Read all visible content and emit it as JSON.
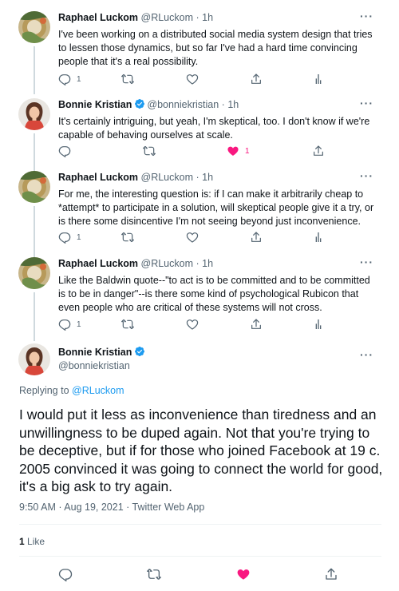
{
  "tweets": [
    {
      "name": "Raphael Luckom",
      "handle": "@RLuckom",
      "time": "1h",
      "verified": false,
      "text": "I've been working on a distributed social media system design that tries to lessen those dynamics, but so far I've had a hard time convincing people that it's a real possibility.",
      "reply_count": "1",
      "retweet_count": "",
      "like_count": "",
      "liked": false
    },
    {
      "name": "Bonnie Kristian",
      "handle": "@bonniekristian",
      "time": "1h",
      "verified": true,
      "text": "It's certainly intriguing, but yeah, I'm skeptical, too. I don't know if we're capable of behaving ourselves at scale.",
      "reply_count": "",
      "retweet_count": "",
      "like_count": "1",
      "liked": true
    },
    {
      "name": "Raphael Luckom",
      "handle": "@RLuckom",
      "time": "1h",
      "verified": false,
      "text": "For me, the interesting question is: if I can make it arbitrarily cheap to *attempt* to participate in a solution, will skeptical people give it a try, or is there some disincentive I'm not seeing beyond just inconvenience.",
      "reply_count": "1",
      "retweet_count": "",
      "like_count": "",
      "liked": false
    },
    {
      "name": "Raphael Luckom",
      "handle": "@RLuckom",
      "time": "1h",
      "verified": false,
      "text": "Like the Baldwin quote--\"to act is to be committed and to be committed is to be in danger\"--is there some kind of psychological Rubicon that even people who are critical of these systems will not cross.",
      "reply_count": "1",
      "retweet_count": "",
      "like_count": "",
      "liked": false
    }
  ],
  "main_tweet": {
    "name": "Bonnie Kristian",
    "handle": "@bonniekristian",
    "verified": true,
    "replying_to_label": "Replying to",
    "replying_to_handle": "@RLuckom",
    "text": "I would put it less as inconvenience than tiredness and an unwillingness to be duped again. Not that you're trying to be deceptive, but if for those who joined Facebook at 19 c. 2005 convinced it was going to connect the world for good, it's a big ask to try again.",
    "timestamp": "9:50 AM · Aug 19, 2021 · Twitter Web App",
    "likes_count": "1",
    "likes_label": "Like",
    "liked": true
  },
  "ui": {
    "separator": " · ",
    "more_glyph": "···"
  },
  "colors": {
    "text": "#0f1419",
    "secondary": "#536471",
    "link": "#1d9bf0",
    "like": "#f91880",
    "verified": "#1d9bf0",
    "border": "#eff3f4"
  },
  "icons": {
    "reply": "reply-icon",
    "retweet": "retweet-icon",
    "like": "heart-icon",
    "share": "share-icon",
    "analytics": "analytics-icon",
    "more": "more-icon",
    "verified": "verified-badge-icon"
  }
}
